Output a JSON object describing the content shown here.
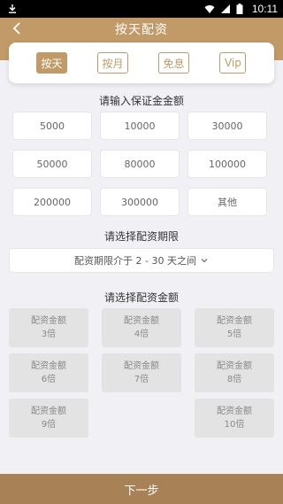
{
  "status_bar": {
    "time": "10:11",
    "icons": [
      "download-icon",
      "wifi-icon",
      "signal-icon",
      "battery-icon"
    ]
  },
  "nav": {
    "title": "按天配资",
    "back_icon": "chevron-left-icon",
    "color": "#c29a67"
  },
  "tabs": [
    {
      "label": "按天",
      "active": true
    },
    {
      "label": "按月",
      "active": false
    },
    {
      "label": "免息",
      "active": false
    },
    {
      "label": "Vip",
      "active": false
    }
  ],
  "deposit": {
    "heading": "请输入保证金金额",
    "options": [
      "5000",
      "10000",
      "30000",
      "50000",
      "80000",
      "100000",
      "200000",
      "300000",
      "其他"
    ]
  },
  "period": {
    "heading": "请选择配资期限",
    "select_text": "配资期限介于 2 - 30 天之间"
  },
  "multiplier": {
    "heading": "请选择配资金额",
    "items": [
      {
        "label": "配资金额",
        "times": "3倍"
      },
      {
        "label": "配资金额",
        "times": "4倍"
      },
      {
        "label": "配资金额",
        "times": "5倍"
      },
      {
        "label": "配资金额",
        "times": "6倍"
      },
      {
        "label": "配资金额",
        "times": "7倍"
      },
      {
        "label": "配资金额",
        "times": "8倍"
      },
      {
        "label": "配资金额",
        "times": "9倍"
      },
      null,
      {
        "label": "配资金额",
        "times": "10倍"
      }
    ]
  },
  "footer": {
    "next_label": "下一步",
    "color": "#a98156"
  }
}
